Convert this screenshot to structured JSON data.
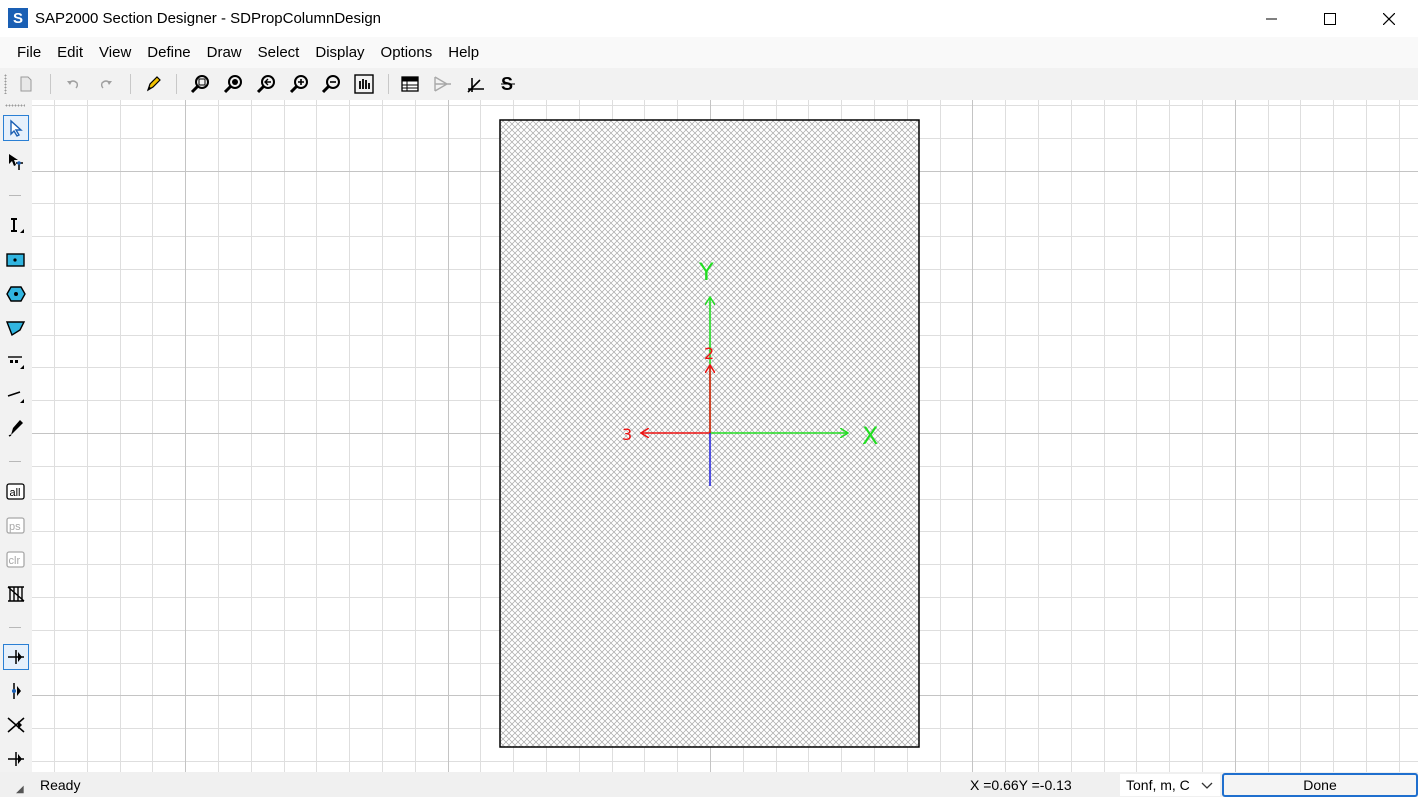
{
  "window": {
    "app_icon_letter": "S",
    "title": "SAP2000 Section Designer - SDPropColumnDesign"
  },
  "menu": [
    "File",
    "Edit",
    "View",
    "Define",
    "Draw",
    "Select",
    "Display",
    "Options",
    "Help"
  ],
  "toolbar": {
    "buttons": [
      "new-icon",
      "undo-icon",
      "redo-icon",
      "pencil-icon",
      "zoom-rubber-band-icon",
      "restore-full-view-icon",
      "previous-zoom-icon",
      "zoom-in-icon",
      "zoom-out-icon",
      "pan-icon",
      "tables-icon",
      "show-section-icon",
      "axes-icon",
      "snap-s-icon"
    ]
  },
  "left_toolbar": {
    "buttons": [
      "pointer-icon",
      "reshape-icon",
      "draw-structural-shape-icon",
      "draw-solid-rectangle-icon",
      "draw-solid-circle-icon",
      "draw-polygon-icon",
      "draw-reinforcing-single-bar-icon",
      "draw-reinforcing-line-icon",
      "draw-reference-line-icon",
      "select-all-icon",
      "previous-selection-icon",
      "clear-selection-icon",
      "intersecting-line-icon",
      "snap-to-points-icon",
      "snap-to-lines-icon",
      "snap-to-intersections-icon",
      "snap-to-edge-icon"
    ],
    "text_labels": {
      "all": "all",
      "ps": "ps",
      "clr": "clr"
    }
  },
  "canvas": {
    "axis_labels": {
      "global_y": "Y",
      "global_x": "X",
      "local_2": "2",
      "local_3": "3"
    },
    "colors": {
      "global_axes": "#22dd22",
      "local_axes": "#ee1111",
      "local_1": "#2020e0",
      "section_outline": "#000000",
      "hatch": "#a0a0a0"
    }
  },
  "status": {
    "text": "Ready",
    "coordinates": "X =0.66Y =-0.13",
    "units": "Tonf, m, C",
    "done_label": "Done"
  }
}
